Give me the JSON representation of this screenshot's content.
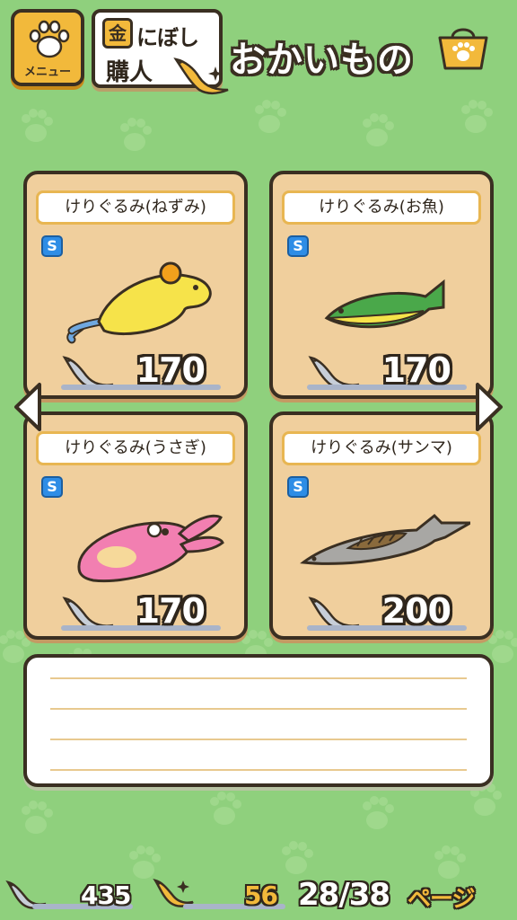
{
  "header": {
    "menu_label": "メニュー",
    "shop_kanji": "金",
    "shop_line1": "にぼし",
    "shop_line2": "購人",
    "title": "おかいもの"
  },
  "items": [
    {
      "name": "けりぐるみ(ねずみ)",
      "rank": "S",
      "price": "170"
    },
    {
      "name": "けりぐるみ(お魚)",
      "rank": "S",
      "price": "170"
    },
    {
      "name": "けりぐるみ(うさぎ)",
      "rank": "S",
      "price": "170"
    },
    {
      "name": "けりぐるみ(サンマ)",
      "rank": "S",
      "price": "200"
    }
  ],
  "footer": {
    "niboshi_count": "435",
    "gold_niboshi_count": "56",
    "page": "28/38",
    "page_suffix": "ページ"
  },
  "colors": {
    "background": "#8fd07d",
    "card": "#f0cf9d",
    "accent_gold": "#f2b93b",
    "badge_blue": "#2e8de6"
  },
  "icons": [
    "paw-icon",
    "niboshi-icon",
    "gold-niboshi-icon",
    "shopping-bag-icon",
    "arrow-left-icon",
    "arrow-right-icon"
  ]
}
